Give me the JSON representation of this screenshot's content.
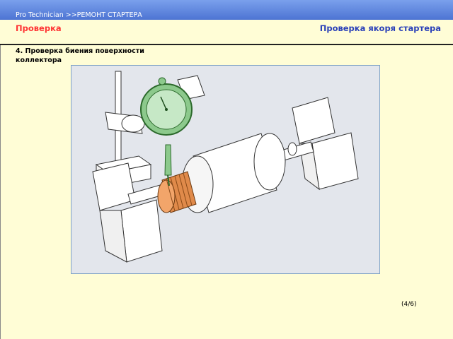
{
  "header": {
    "breadcrumb": "Pro  Technician >>РЕМОНТ СТАРТЕРА",
    "section_label": "Проверка",
    "section_title": "Проверка якоря стартера"
  },
  "content": {
    "step_text": "4. Проверка биения поверхности коллектора"
  },
  "footer": {
    "page_counter": "(4/6)"
  },
  "colors": {
    "header_blue": "#3b63c9",
    "section_label_red": "#ff3333",
    "section_title_blue": "#2a40b8",
    "background_yellow": "#fffdd6",
    "dial_green": "#8cc98c",
    "commutator_orange": "#e08a4a"
  }
}
